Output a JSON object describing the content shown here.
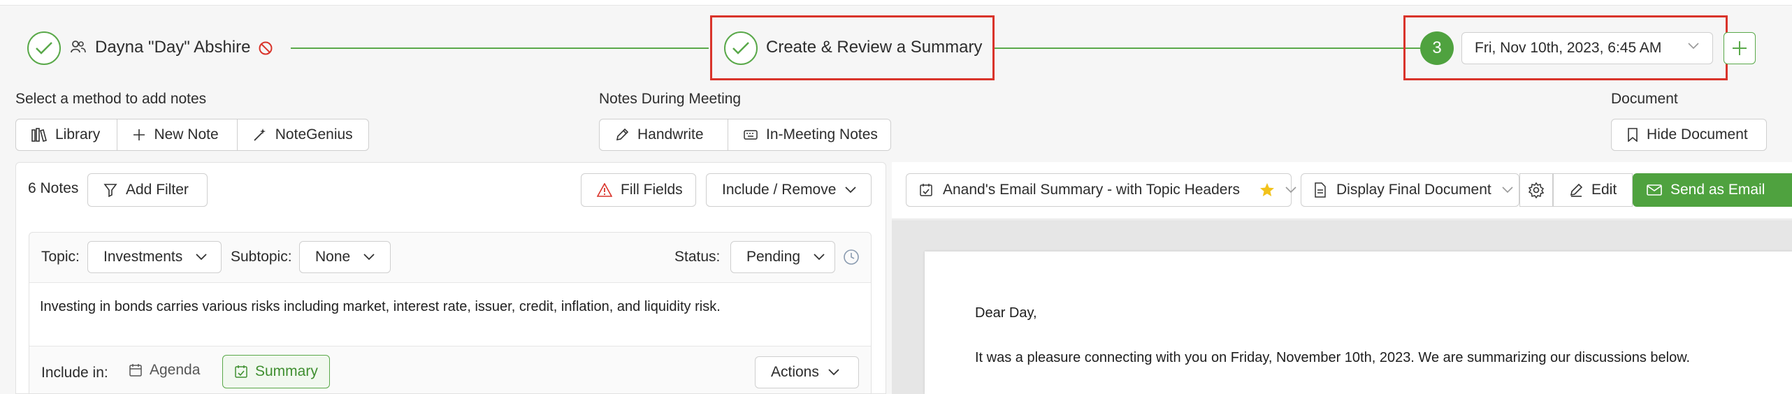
{
  "stepper": {
    "client_name": "Dayna \"Day\" Abshire",
    "step_title": "Create & Review a Summary",
    "meeting_number": "3",
    "meeting_date": "Fri, Nov 10th, 2023, 6:45 AM"
  },
  "add_notes": {
    "label": "Select a method to add notes",
    "buttons": [
      "Library",
      "New Note",
      "NoteGenius"
    ]
  },
  "during_meeting": {
    "label": "Notes During Meeting",
    "buttons": [
      "Handwrite",
      "In-Meeting Notes"
    ]
  },
  "document": {
    "label": "Document",
    "hide_button": "Hide Document"
  },
  "notes_panel": {
    "count": "6 Notes",
    "add_filter": "Add Filter",
    "fill_fields": "Fill Fields",
    "include_remove": "Include / Remove"
  },
  "note_card": {
    "topic_label": "Topic:",
    "topic_value": "Investments",
    "subtopic_label": "Subtopic:",
    "subtopic_value": "None",
    "status_label": "Status:",
    "status_value": "Pending",
    "text": "Investing in bonds carries various risks including market, interest rate, issuer, credit, inflation, and liquidity risk.",
    "include_label": "Include in:",
    "include_agenda": "Agenda",
    "include_summary": "Summary",
    "actions": "Actions"
  },
  "doc_toolbar": {
    "template": "Anand's Email Summary - with Topic Headers",
    "display": "Display Final Document",
    "edit": "Edit",
    "send": "Send as Email"
  },
  "doc_page": {
    "greeting": "Dear Day,",
    "line1": "It was a pleasure connecting with you on Friday, November 10th, 2023. We are summarizing our discussions below."
  },
  "colors": {
    "accent_green": "#4fa23f",
    "highlight_red": "#d9342b",
    "star_yellow": "#f2c21b"
  }
}
